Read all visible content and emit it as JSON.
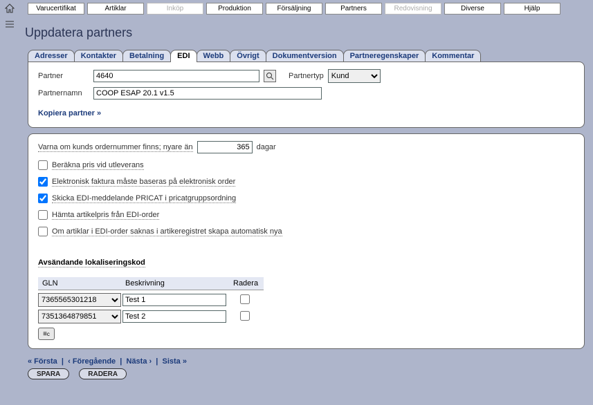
{
  "topMenu": [
    {
      "label": "Varucertifikat",
      "disabled": false
    },
    {
      "label": "Artiklar",
      "disabled": false
    },
    {
      "label": "Inköp",
      "disabled": true
    },
    {
      "label": "Produktion",
      "disabled": false
    },
    {
      "label": "Försäljning",
      "disabled": false
    },
    {
      "label": "Partners",
      "disabled": false
    },
    {
      "label": "Redovisning",
      "disabled": true
    },
    {
      "label": "Diverse",
      "disabled": false
    },
    {
      "label": "Hjälp",
      "disabled": false
    }
  ],
  "page": {
    "title": "Uppdatera partners"
  },
  "subtabs": [
    "Adresser",
    "Kontakter",
    "Betalning",
    "EDI",
    "Webb",
    "Övrigt",
    "Dokumentversion",
    "Partneregenskaper",
    "Kommentar"
  ],
  "activeSubtab": "EDI",
  "partner": {
    "label": "Partner",
    "value": "4640",
    "typeLabel": "Partnertyp",
    "typeValue": "Kund",
    "nameLabel": "Partnernamn",
    "nameValue": "COOP ESAP 20.1 v1.5",
    "copyLink": "Kopiera partner »"
  },
  "edi": {
    "warnPre": "Varna om kunds ordernummer finns; nyare än",
    "warnDays": "365",
    "warnPost": "dagar",
    "options": [
      {
        "label": "Beräkna pris vid utleverans",
        "checked": false
      },
      {
        "label": "Elektronisk faktura måste baseras på elektronisk order",
        "checked": true
      },
      {
        "label": "Skicka EDI-meddelande PRICAT i pricatgruppsordning",
        "checked": true
      },
      {
        "label": "Hämta artikelpris från EDI-order",
        "checked": false
      },
      {
        "label": "Om artiklar i EDI-order saknas i artikeregistret skapa automatisk nya",
        "checked": false
      }
    ],
    "sectionHeader": "Avsändande lokaliseringskod",
    "columns": {
      "gln": "GLN",
      "besk": "Beskrivning",
      "radera": "Radera"
    },
    "rows": [
      {
        "gln": "7365565301218",
        "besk": "Test 1",
        "radera": false
      },
      {
        "gln": "7351364879851",
        "besk": "Test 2",
        "radera": false
      }
    ]
  },
  "pager": {
    "first": "« Första",
    "prev": "‹ Föregående",
    "next": "Nästa ›",
    "last": "Sista »"
  },
  "actions": {
    "save": "SPARA",
    "delete": "RADERA"
  }
}
